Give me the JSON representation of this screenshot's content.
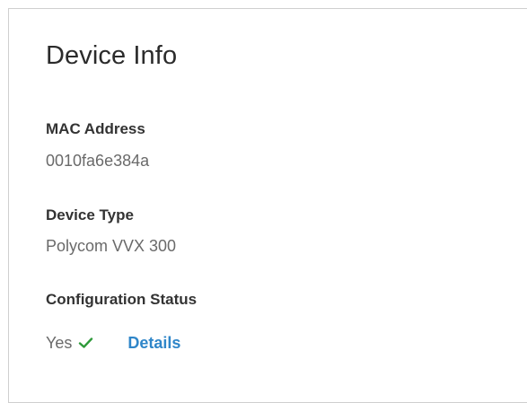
{
  "card": {
    "title": "Device Info",
    "mac": {
      "label": "MAC Address",
      "value": "0010fa6e384a"
    },
    "device_type": {
      "label": "Device Type",
      "value": "Polycom VVX 300"
    },
    "config_status": {
      "label": "Configuration Status",
      "value": "Yes",
      "status_icon": "check-icon",
      "details_label": "Details"
    }
  },
  "colors": {
    "title": "#2b2b2b",
    "label": "#333333",
    "value": "#6a6a6a",
    "link": "#2f86c9",
    "check": "#2e9a3a",
    "border": "#cfcfcf"
  }
}
